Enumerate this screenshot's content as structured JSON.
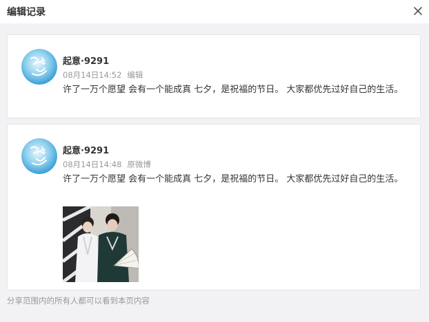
{
  "dialog": {
    "title": "编辑记录",
    "close_icon": "close-icon"
  },
  "records": [
    {
      "username": "起意·9291",
      "time": "08月14日14:52",
      "tag": "编辑",
      "text": "许了一万个愿望 会有一个能成真 七夕，是祝福的节日。 大家都优先过好自己的生活。"
    },
    {
      "username": "起意·9291",
      "time": "08月14日14:48",
      "tag": "原微博",
      "text": "许了一万个愿望 会有一个能成真 七夕，是祝福的节日。 大家都优先过好自己的生活。"
    }
  ],
  "footer": {
    "note": "分享范围内的所有人都可以看到本页内容"
  },
  "colors": {
    "background": "#f2f2f5",
    "text": "#333333",
    "muted": "#999999",
    "avatar_accent": "#4aa9d8"
  }
}
